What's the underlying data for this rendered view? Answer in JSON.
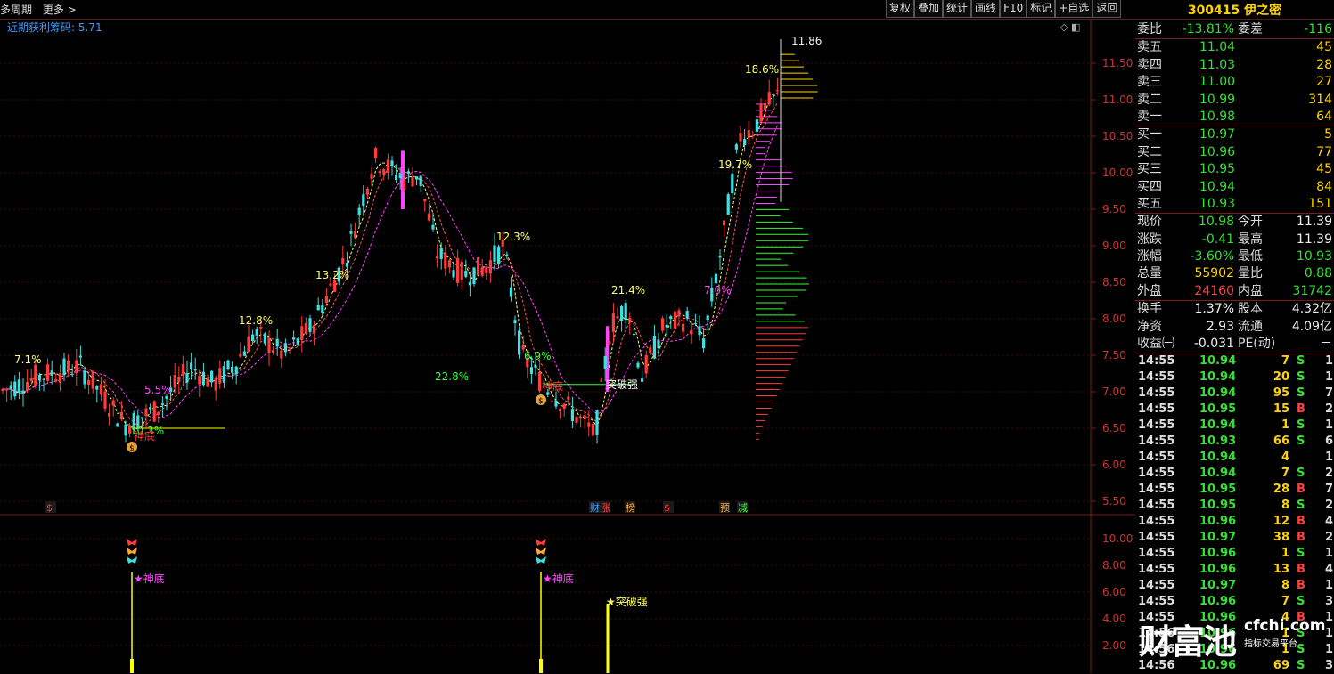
{
  "topbar": {
    "period": "多周期",
    "more": "更多 >"
  },
  "toolbar": [
    "复权",
    "叠加",
    "统计",
    "画线",
    "F10",
    "标记",
    "+自选",
    "返回"
  ],
  "stock": {
    "code": "300415",
    "name": "伊之密"
  },
  "indicator": {
    "label": "近期获利筹码: 5.71"
  },
  "chart_data": {
    "type": "candlestick",
    "price_axis": [
      "11.50",
      "11.00",
      "10.50",
      "10.00",
      "9.50",
      "9.00",
      "8.50",
      "8.00",
      "7.50",
      "7.00",
      "6.50",
      "6.00",
      "5.50"
    ],
    "lower_axis": [
      "10.00",
      "8.00",
      "6.00",
      "4.00",
      "2.00"
    ],
    "high_label": "11.86",
    "annotations": [
      "7.1%",
      "5.5%",
      "10.3%",
      "神底",
      "12.8%",
      "13.2%",
      "22.8%",
      "12.3%",
      "6.9%",
      "神底",
      "21.4%",
      "突破强",
      "7.0%",
      "19.7%",
      "18.6%"
    ],
    "event_labels": [
      "$",
      "财",
      "涨",
      "榜",
      "$",
      "预",
      "减"
    ],
    "lower_annotations": [
      "★神底",
      "★神底",
      "★突破强"
    ]
  },
  "quote": {
    "wb": {
      "label": "委比",
      "value": "-13.81%",
      "label2": "委差",
      "value2": "-116"
    },
    "asks": [
      {
        "label": "卖五",
        "price": "11.04",
        "vol": "45"
      },
      {
        "label": "卖四",
        "price": "11.03",
        "vol": "28"
      },
      {
        "label": "卖三",
        "price": "11.00",
        "vol": "27"
      },
      {
        "label": "卖二",
        "price": "10.99",
        "vol": "314"
      },
      {
        "label": "卖一",
        "price": "10.98",
        "vol": "64"
      }
    ],
    "bids": [
      {
        "label": "买一",
        "price": "10.97",
        "vol": "5"
      },
      {
        "label": "买二",
        "price": "10.96",
        "vol": "77"
      },
      {
        "label": "买三",
        "price": "10.95",
        "vol": "45"
      },
      {
        "label": "买四",
        "price": "10.94",
        "vol": "84"
      },
      {
        "label": "买五",
        "price": "10.93",
        "vol": "151"
      }
    ],
    "stats": [
      {
        "l1": "现价",
        "v1": "10.98",
        "c1": "grn",
        "l2": "今开",
        "v2": "11.39",
        "c2": "wht"
      },
      {
        "l1": "涨跌",
        "v1": "-0.41",
        "c1": "grn",
        "l2": "最高",
        "v2": "11.39",
        "c2": "wht"
      },
      {
        "l1": "涨幅",
        "v1": "-3.60%",
        "c1": "grn",
        "l2": "最低",
        "v2": "10.93",
        "c2": "grn"
      },
      {
        "l1": "总量",
        "v1": "55902",
        "c1": "yel",
        "l2": "量比",
        "v2": "0.88",
        "c2": "grn"
      },
      {
        "l1": "外盘",
        "v1": "24160",
        "c1": "red",
        "l2": "内盘",
        "v2": "31742",
        "c2": "grn"
      }
    ],
    "stats2": [
      {
        "l1": "换手",
        "v1": "1.37%",
        "c1": "wht",
        "l2": "股本",
        "v2": "4.32亿",
        "c2": "wht"
      },
      {
        "l1": "净资",
        "v1": "2.93",
        "c1": "wht",
        "l2": "流通",
        "v2": "4.09亿",
        "c2": "wht"
      },
      {
        "l1": "收益㈠",
        "v1": "-0.031",
        "c1": "wht",
        "l2": "PE(动)",
        "v2": "－",
        "c2": "wht"
      }
    ]
  },
  "ticks": [
    {
      "t": "14:55",
      "p": "10.94",
      "v": "7",
      "s": "S",
      "n": "1"
    },
    {
      "t": "14:55",
      "p": "10.94",
      "v": "20",
      "s": "S",
      "n": "1"
    },
    {
      "t": "14:55",
      "p": "10.94",
      "v": "95",
      "s": "S",
      "n": "7"
    },
    {
      "t": "14:55",
      "p": "10.95",
      "v": "15",
      "s": "B",
      "n": "2"
    },
    {
      "t": "14:55",
      "p": "10.94",
      "v": "1",
      "s": "S",
      "n": "1"
    },
    {
      "t": "14:55",
      "p": "10.93",
      "v": "66",
      "s": "S",
      "n": "6"
    },
    {
      "t": "14:55",
      "p": "10.94",
      "v": "4",
      "s": "",
      "n": "1"
    },
    {
      "t": "14:55",
      "p": "10.94",
      "v": "7",
      "s": "S",
      "n": "2"
    },
    {
      "t": "14:55",
      "p": "10.95",
      "v": "28",
      "s": "B",
      "n": "7"
    },
    {
      "t": "14:55",
      "p": "10.95",
      "v": "8",
      "s": "S",
      "n": "2"
    },
    {
      "t": "14:55",
      "p": "10.96",
      "v": "12",
      "s": "B",
      "n": "4"
    },
    {
      "t": "14:55",
      "p": "10.97",
      "v": "38",
      "s": "B",
      "n": "2"
    },
    {
      "t": "14:55",
      "p": "10.96",
      "v": "1",
      "s": "S",
      "n": "1"
    },
    {
      "t": "14:55",
      "p": "10.96",
      "v": "13",
      "s": "B",
      "n": "4"
    },
    {
      "t": "14:55",
      "p": "10.97",
      "v": "8",
      "s": "B",
      "n": "1"
    },
    {
      "t": "14:55",
      "p": "10.96",
      "v": "7",
      "s": "S",
      "n": "3"
    },
    {
      "t": "14:55",
      "p": "10.96",
      "v": "4",
      "s": "B",
      "n": "1"
    },
    {
      "t": "14:56",
      "p": "10.96",
      "v": "1",
      "s": "S",
      "n": "1"
    },
    {
      "t": "14:56",
      "p": "10.96",
      "v": "1",
      "s": "S",
      "n": "1"
    },
    {
      "t": "14:56",
      "p": "10.96",
      "v": "69",
      "s": "S",
      "n": "3"
    }
  ],
  "watermark": {
    "brand": "财富池",
    "site": "cfchi.com",
    "tagline": "指标交易平台"
  }
}
